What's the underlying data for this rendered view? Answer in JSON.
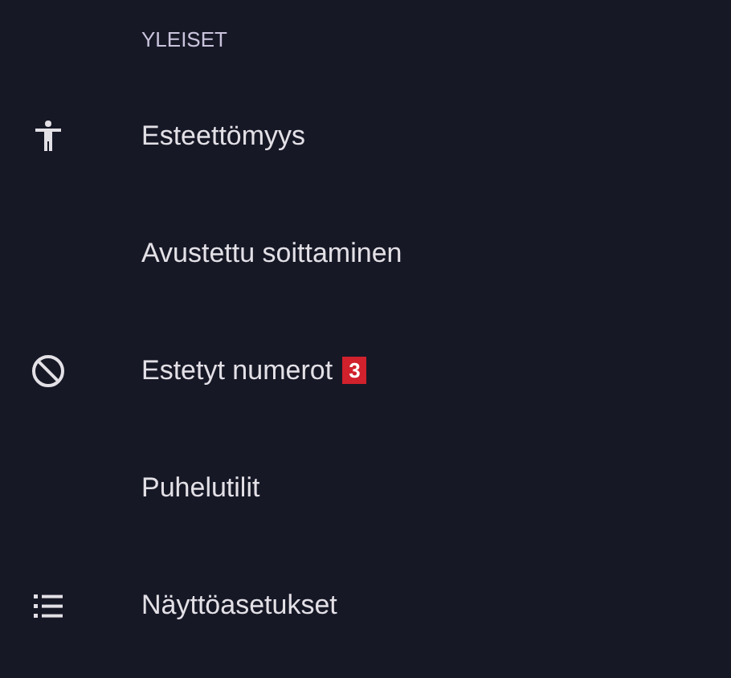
{
  "section_header": "YLEISET",
  "items": [
    {
      "label": "Esteettömyys",
      "kind": "accessibility"
    },
    {
      "label": "Avustettu soittaminen",
      "kind": "plain"
    },
    {
      "label": "Estetyt numerot",
      "kind": "blocked",
      "badge": "3"
    },
    {
      "label": "Puhelutilit",
      "kind": "plain"
    },
    {
      "label": "Näyttöasetukset",
      "kind": "display"
    }
  ]
}
